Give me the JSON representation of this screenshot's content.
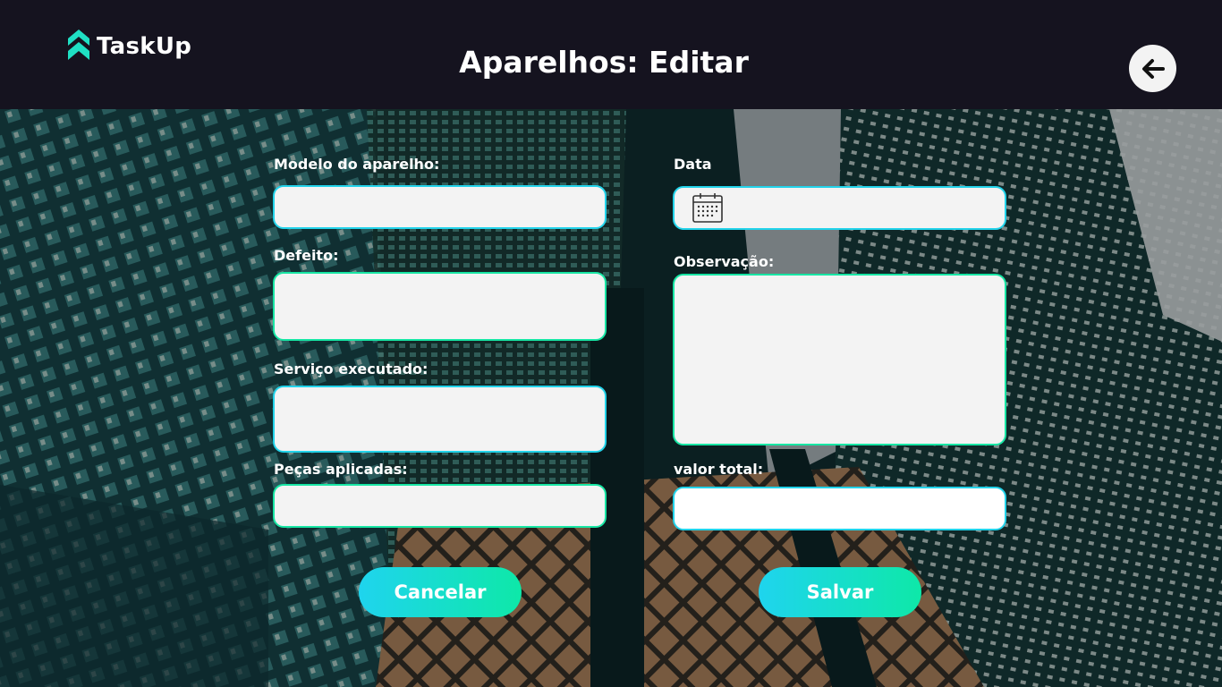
{
  "app": {
    "name": "TaskUp"
  },
  "header": {
    "title": "Aparelhos: Editar",
    "back_icon": "arrow-left-icon"
  },
  "form": {
    "modelo": {
      "label": "Modelo do aparelho:",
      "value": ""
    },
    "data": {
      "label": "Data",
      "value": "",
      "icon": "calendar-icon"
    },
    "defeito": {
      "label": "Defeito:",
      "value": ""
    },
    "observacao": {
      "label": "Observação:",
      "value": ""
    },
    "servico": {
      "label": "Serviço executado:",
      "value": ""
    },
    "pecas": {
      "label": "Peças aplicadas:",
      "value": ""
    },
    "valor": {
      "label": "valor total:",
      "value": ""
    }
  },
  "actions": {
    "cancel_label": "Cancelar",
    "save_label": "Salvar"
  },
  "colors": {
    "accent_cyan": "#22d3ea",
    "accent_green": "#17e6a4",
    "topbar": "#15131f"
  }
}
